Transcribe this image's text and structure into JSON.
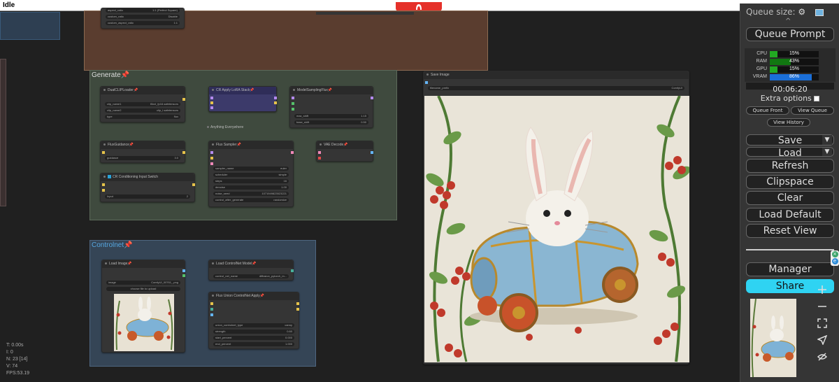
{
  "window": {
    "title": "Idle"
  },
  "colors": {
    "generate_group": "#3f4a3e",
    "controlnet_group": "#354556",
    "misc_group": "#5a3d2f",
    "accent_blue": "#29a3d8",
    "share_bg": "#2fd3f2"
  },
  "top_node": {
    "rows": [
      {
        "label": "aspect_ratio",
        "value": "1:1 (Perfect Square)"
      },
      {
        "label": "custom_ratio",
        "value": "Disable"
      },
      {
        "label": "custom_aspect_ratio",
        "value": "1:1"
      }
    ]
  },
  "groups": {
    "generate": {
      "title": "Generate📌"
    },
    "controlnet": {
      "title": "Controlnet📌"
    }
  },
  "nodes": {
    "dual_clip": {
      "title": "DualCLIPLoader📌",
      "rows": [
        {
          "label": "clip_name1",
          "value": "t5xxl_fp16.safetensors"
        },
        {
          "label": "clip_name2",
          "value": "clip_l.safetensors"
        },
        {
          "label": "type",
          "value": "flux"
        }
      ]
    },
    "lora_stack": {
      "title": "CR Apply LoRA Stack📌"
    },
    "model_sampling": {
      "title": "ModelSamplingFlux📌",
      "rows": [
        {
          "label": "max_shift",
          "value": "1.15"
        },
        {
          "label": "base_shift",
          "value": "0.50"
        }
      ]
    },
    "anything_everywhere": {
      "title": "Anything Everywhere"
    },
    "flux_guidance": {
      "title": "FluxGuidance📌",
      "rows": [
        {
          "label": "guidance",
          "value": "3.0"
        }
      ]
    },
    "flux_sampler": {
      "title": "Flux Sampler📌",
      "rows": [
        {
          "label": "sampler_name",
          "value": "euler"
        },
        {
          "label": "scheduler",
          "value": "simple"
        },
        {
          "label": "steps",
          "value": "16"
        },
        {
          "label": "denoise",
          "value": "1.00"
        },
        {
          "label": "noise_seed",
          "value": "1071949823523221"
        },
        {
          "label": "control_after_generate",
          "value": "randomize"
        }
      ]
    },
    "vae_decode": {
      "title": "VAE Decode📌"
    },
    "cr_switch": {
      "title": "CR Conditioning Input Switch",
      "rows": [
        {
          "label": "Input",
          "value": "2"
        }
      ]
    },
    "load_image": {
      "title": "Load Image📌",
      "rows": [
        {
          "label": "image",
          "value": "ComfyUI_00761_.png"
        }
      ],
      "upload_label": "choose file to upload"
    },
    "load_controlnet": {
      "title": "Load ControlNet Model📌",
      "rows": [
        {
          "label": "control_net_name",
          "value": "diffusion_pytorch_m..."
        }
      ]
    },
    "union_apply": {
      "title": "Flux Union ControlNet Apply📌",
      "rows": [
        {
          "label": "union_controlnet_type",
          "value": "canny"
        },
        {
          "label": "strength",
          "value": "0.60"
        },
        {
          "label": "start_percent",
          "value": "0.000"
        },
        {
          "label": "end_percent",
          "value": "1.000"
        }
      ]
    },
    "save_image": {
      "title": "Save Image",
      "rows": [
        {
          "label": "filename_prefix",
          "value": "ComfyUI"
        }
      ]
    }
  },
  "stats": {
    "t": "T: 0.00s",
    "i": "I: 0",
    "n": "N: 23 [14]",
    "v": "V: 74",
    "fps": "FPS:53.19"
  },
  "sidebar": {
    "queue_size_label": "Queue size:",
    "queue_prompt": "Queue Prompt",
    "monitor": [
      {
        "label": "CPU",
        "value": "15%",
        "fraction": 0.15,
        "color": "#22aa22"
      },
      {
        "label": "RAM",
        "value": "43%",
        "fraction": 0.43,
        "color": "#117711"
      },
      {
        "label": "GPU",
        "value": "15%",
        "fraction": 0.15,
        "color": "#22aa22"
      },
      {
        "label": "VRAM",
        "value": "86%",
        "fraction": 0.86,
        "color": "#1b6fd8"
      }
    ],
    "timer": "00:06:20",
    "extra_options": "Extra options",
    "queue_front": "Queue Front",
    "view_queue": "View Queue",
    "view_history": "View History",
    "save": "Save",
    "load": "Load",
    "refresh": "Refresh",
    "clipspace": "Clipspace",
    "clear": "Clear",
    "load_default": "Load Default",
    "reset_view": "Reset View",
    "manager": "Manager",
    "share": "Share"
  }
}
